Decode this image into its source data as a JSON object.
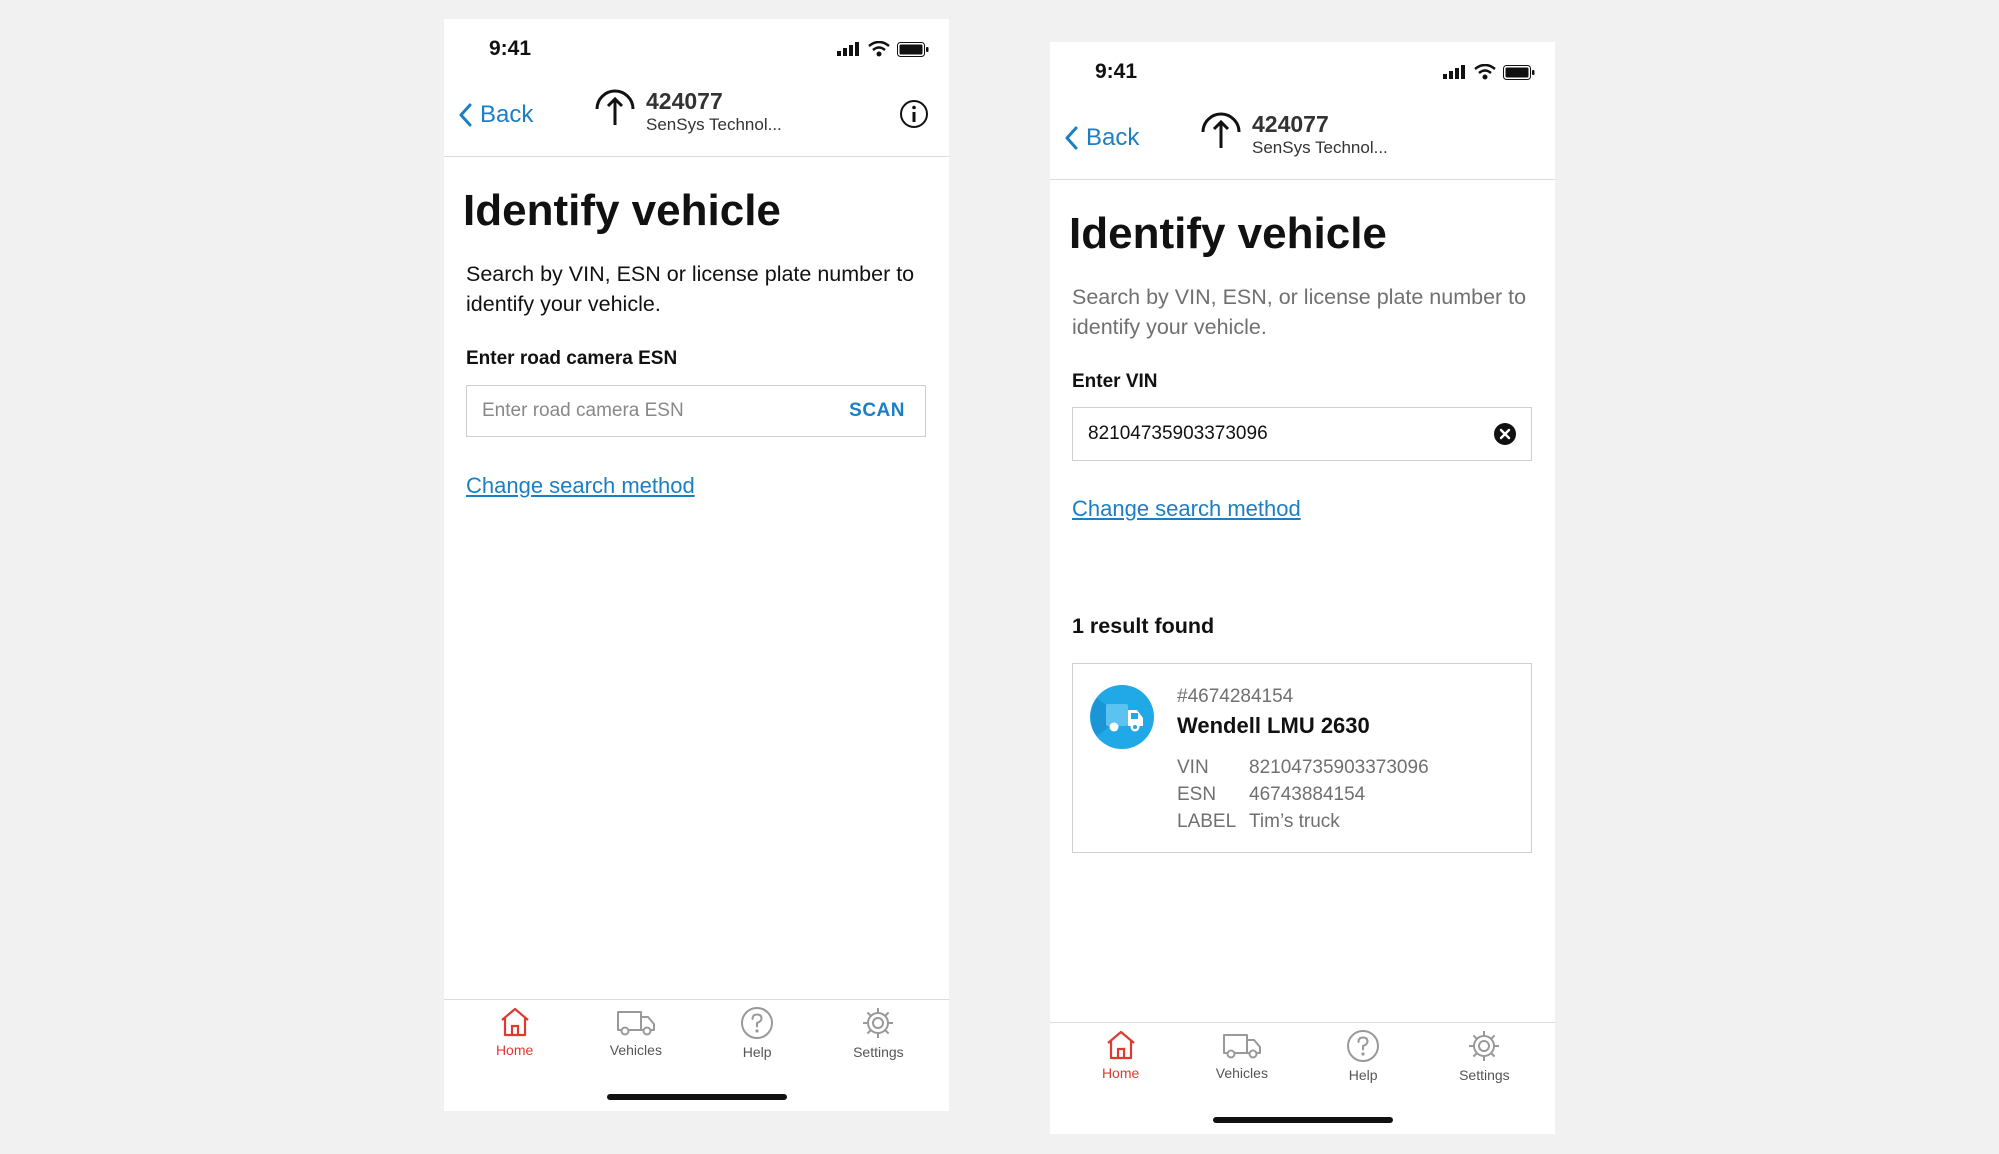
{
  "colors": {
    "accent": "#1b7fc4",
    "active_tab": "#e03a2f",
    "background": "#f1f1f1"
  },
  "screens": [
    {
      "status": {
        "time": "9:41"
      },
      "nav": {
        "back_label": "Back",
        "device_id": "424077",
        "device_vendor": "SenSys Technol...",
        "show_info": true
      },
      "title": "Identify vehicle",
      "description": "Search by VIN, ESN or license plate number to identify your vehicle.",
      "field_label": "Enter road camera ESN",
      "input": {
        "value": "",
        "placeholder": "Enter road camera ESN",
        "action_label": "SCAN"
      },
      "change_link": "Change search method",
      "tabs": [
        {
          "label": "Home",
          "icon": "home-icon",
          "active": true
        },
        {
          "label": "Vehicles",
          "icon": "van-icon",
          "active": false
        },
        {
          "label": "Help",
          "icon": "help-icon",
          "active": false
        },
        {
          "label": "Settings",
          "icon": "gear-icon",
          "active": false
        }
      ]
    },
    {
      "status": {
        "time": "9:41"
      },
      "nav": {
        "back_label": "Back",
        "device_id": "424077",
        "device_vendor": "SenSys Technol...",
        "show_info": false
      },
      "title": "Identify vehicle",
      "description": "Search by VIN, ESN, or license plate number to identify your vehicle.",
      "field_label": "Enter VIN",
      "input": {
        "value": "82104735903373096",
        "placeholder": ""
      },
      "change_link": "Change search method",
      "results": {
        "title": "1 result found",
        "items": [
          {
            "ref": "#4674284154",
            "name": "Wendell LMU 2630",
            "vin_key": "VIN",
            "vin": "82104735903373096",
            "esn_key": "ESN",
            "esn": "46743884154",
            "label_key": "LABEL",
            "label": "Tim’s truck"
          }
        ]
      },
      "tabs": [
        {
          "label": "Home",
          "icon": "home-icon",
          "active": true
        },
        {
          "label": "Vehicles",
          "icon": "van-icon",
          "active": false
        },
        {
          "label": "Help",
          "icon": "help-icon",
          "active": false
        },
        {
          "label": "Settings",
          "icon": "gear-icon",
          "active": false
        }
      ]
    }
  ]
}
